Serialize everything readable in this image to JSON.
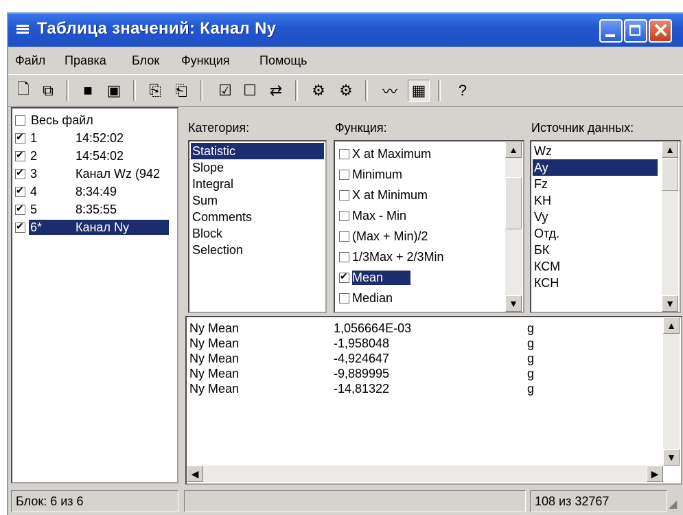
{
  "window": {
    "title": "Таблица значений: Канал Ny"
  },
  "menu": [
    "Файл",
    "Правка",
    "Блок",
    "Функция",
    "Помощь"
  ],
  "toolbar_icons": [
    "new-icon",
    "copy-icon",
    "save-icon",
    "save-all-icon",
    "copy-clipboard-icon",
    "paste-icon",
    "check-list-icon",
    "uncheck-list-icon",
    "toggle-check-icon",
    "gear-icon",
    "gear-grid-icon",
    "waveform-icon",
    "table-view-icon",
    "help-icon"
  ],
  "files": {
    "all_label": "Весь файл",
    "items": [
      {
        "num": "1",
        "time": "14:52:02",
        "checked": true
      },
      {
        "num": "2",
        "time": "14:54:02",
        "checked": true
      },
      {
        "num": "3",
        "time": "Канал Wz (942",
        "checked": true
      },
      {
        "num": "4",
        "time": "8:34:49",
        "checked": true
      },
      {
        "num": "5",
        "time": "8:35:55",
        "checked": true
      },
      {
        "num": "6*",
        "time": "Канал Ny",
        "checked": true,
        "selected": true
      }
    ]
  },
  "category": {
    "label": "Категория:",
    "items": [
      "Statistic",
      "Slope",
      "Integral",
      "Sum",
      "Comments",
      "Block",
      "Selection"
    ],
    "selected": "Statistic"
  },
  "function": {
    "label": "Функция:",
    "items": [
      {
        "label": "X at Maximum",
        "checked": false
      },
      {
        "label": "Minimum",
        "checked": false
      },
      {
        "label": "X at Minimum",
        "checked": false
      },
      {
        "label": "Max - Min",
        "checked": false
      },
      {
        "label": "(Max + Min)/2",
        "checked": false
      },
      {
        "label": "1/3Max + 2/3Min",
        "checked": false
      },
      {
        "label": "Mean",
        "checked": true,
        "selected": true
      },
      {
        "label": "Median",
        "checked": false
      }
    ]
  },
  "source": {
    "label": "Источник данных:",
    "items": [
      "Wz",
      "Ay",
      "Fz",
      "KH",
      "Vy",
      "Отд.",
      "БК",
      "КСМ",
      "КСН"
    ],
    "selected": "Ay"
  },
  "results": [
    {
      "name": "Ny Mean",
      "value": "1,056664E-03",
      "unit": "g"
    },
    {
      "name": "Ny Mean",
      "value": "-1,958048",
      "unit": "g"
    },
    {
      "name": "Ny Mean",
      "value": "-4,924647",
      "unit": "g"
    },
    {
      "name": "Ny Mean",
      "value": "-9,889995",
      "unit": "g"
    },
    {
      "name": "Ny Mean",
      "value": "-14,81322",
      "unit": "g"
    }
  ],
  "status": {
    "block": "Блок: 6 из 6",
    "middle": "",
    "count": "108 из 32767"
  }
}
